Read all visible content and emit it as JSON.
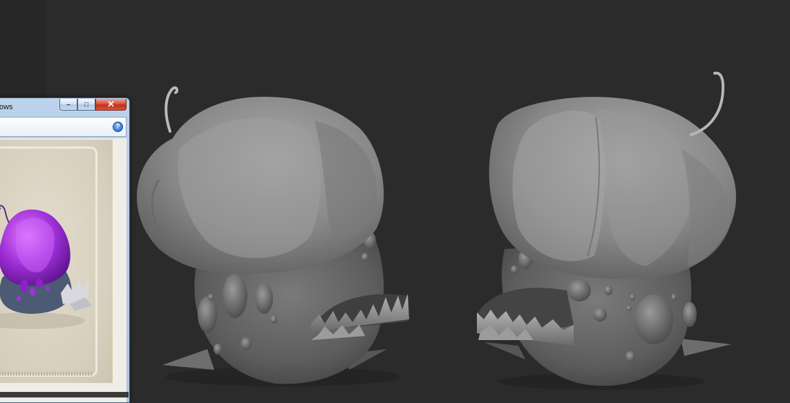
{
  "viewer_window": {
    "title": "ows",
    "buttons": {
      "minimize_glyph": "–",
      "maximize_glyph": "□",
      "close_glyph": "✕"
    },
    "help_glyph": "?"
  },
  "colors": {
    "viewport_background": "#2b2b2b",
    "sculpt_clay": "#8e8e8e",
    "concept_purple": "#9b2fd6",
    "concept_body": "#4f5f78"
  },
  "icons": [
    "minimize-icon",
    "maximize-icon",
    "close-icon",
    "help-icon"
  ]
}
